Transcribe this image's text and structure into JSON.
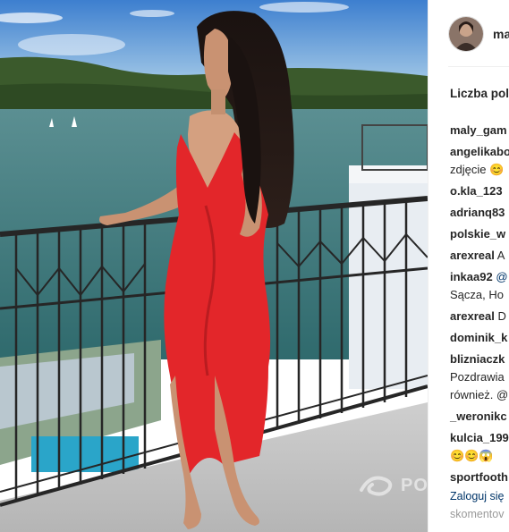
{
  "post": {
    "username": "ma",
    "likes_label": "Liczba pol"
  },
  "comments": [
    {
      "user": "maly_gam",
      "text": ""
    },
    {
      "user": "angelikabo",
      "text": "",
      "extra": "zdjęcie 😊"
    },
    {
      "user": "o.kla_123",
      "text": ""
    },
    {
      "user": "adrianq83",
      "text": ""
    },
    {
      "user": "polskie_w",
      "text": ""
    },
    {
      "user": "arexreal",
      "text": "A"
    },
    {
      "user": "inkaa92",
      "text": "",
      "mention": "@",
      "extra": "Sącza, Ho"
    },
    {
      "user": "arexreal",
      "text": "D"
    },
    {
      "user": "dominik_k",
      "text": ""
    },
    {
      "user": "blizniaczk",
      "text": "",
      "extra": "Pozdrawia",
      "extra2": "również. @"
    },
    {
      "user": "_weronikc",
      "text": ""
    },
    {
      "user": "kulcia_199",
      "text": "",
      "extra": "😊😊😱"
    },
    {
      "user": "sportfooth",
      "text": ""
    }
  ],
  "footer": {
    "login_link": "Zaloguj się",
    "sub_text": "skomentov"
  },
  "watermark": {
    "text": "PO"
  },
  "icons": {
    "avatar": "avatar-image",
    "watermark_logo": "swirl-logo-icon"
  },
  "colors": {
    "sky": "#5f9dd6",
    "lake": "#4d8f94",
    "dress": "#e8272b",
    "railing": "#2a2a2a"
  }
}
